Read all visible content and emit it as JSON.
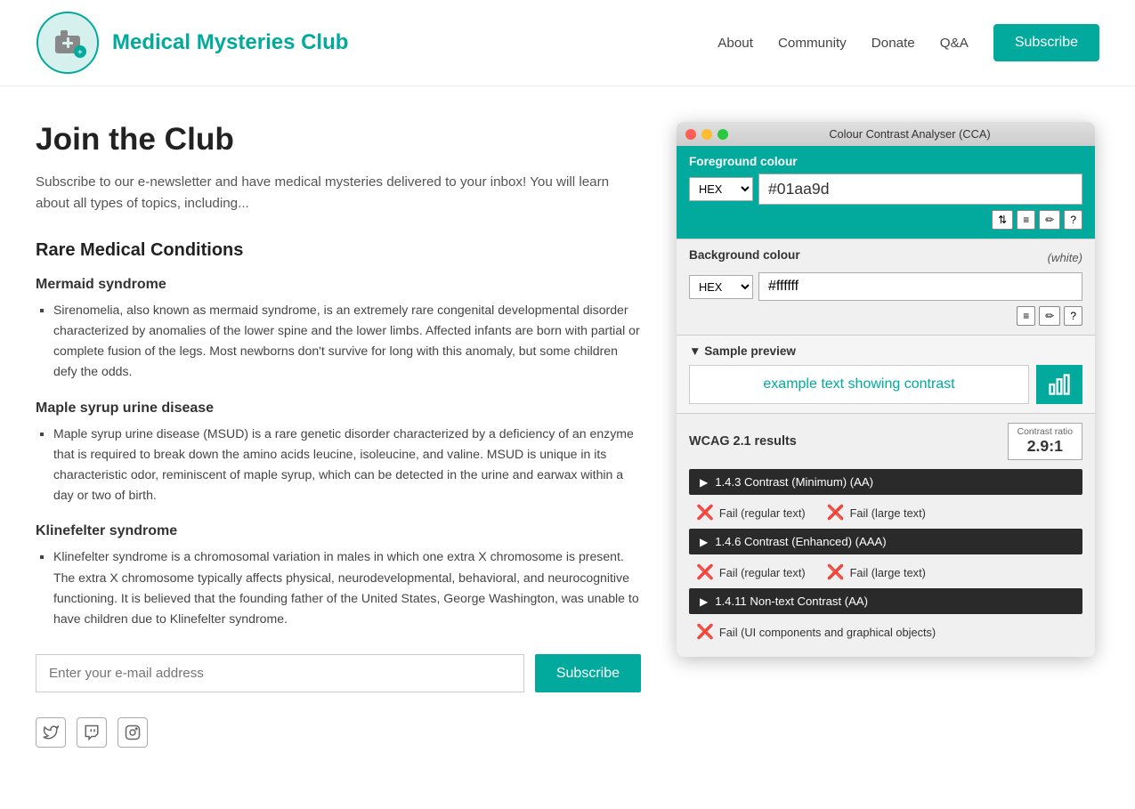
{
  "header": {
    "site_title": "Medical Mysteries Club",
    "logo_alt": "Medical Mysteries Club logo",
    "nav": {
      "about": "About",
      "community": "Community",
      "donate": "Donate",
      "qa": "Q&A",
      "subscribe": "Subscribe"
    }
  },
  "main": {
    "page_title": "Join the Club",
    "intro": "Subscribe to our e-newsletter and have medical mysteries delivered to your inbox! You will learn about all types of topics, including...",
    "section_title": "Rare Medical Conditions",
    "conditions": [
      {
        "title": "Mermaid syndrome",
        "text": "Sirenomelia, also known as mermaid syndrome, is an extremely rare congenital developmental disorder characterized by anomalies of the lower spine and the lower limbs. Affected infants are born with partial or complete fusion of the legs. Most newborns don't survive for long with this anomaly, but some children defy the odds."
      },
      {
        "title": "Maple syrup urine disease",
        "text": "Maple syrup urine disease (MSUD) is a rare genetic disorder characterized by a deficiency of an enzyme that is required to break down the amino acids leucine, isoleucine, and valine. MSUD is unique in its characteristic odor, reminiscent of maple syrup, which can be detected in the urine and earwax within a day or two of birth."
      },
      {
        "title": "Klinefelter syndrome",
        "text": "Klinefelter syndrome is a chromosomal variation in males in which one extra X chromosome is present. The extra X chromosome typically affects physical, neurodevelopmental, behavioral, and neurocognitive functioning. It is believed that the founding father of the United States, George Washington, was unable to have children due to Klinefelter syndrome."
      }
    ],
    "email_placeholder": "Enter your e-mail address",
    "subscribe_label": "Subscribe"
  },
  "social": {
    "icons": [
      "twitter-icon",
      "twitch-icon",
      "instagram-icon"
    ]
  },
  "cca": {
    "title": "Colour Contrast Analyser (CCA)",
    "fg_label": "Foreground colour",
    "fg_format": "HEX",
    "fg_value": "#01aa9d",
    "bg_label": "Background colour",
    "bg_note": "(white)",
    "bg_format": "HEX",
    "bg_value": "#ffffff",
    "sample_preview_header": "▼ Sample preview",
    "sample_text": "example text showing contrast",
    "wcag_header": "WCAG 2.1 results",
    "contrast_label": "Contrast ratio",
    "contrast_value": "2.9:1",
    "results": [
      {
        "id": "1.4.3",
        "label": "1.4.3 Contrast (Minimum) (AA)",
        "fail_regular": "Fail (regular text)",
        "fail_large": "Fail (large text)"
      },
      {
        "id": "1.4.6",
        "label": "1.4.6 Contrast (Enhanced) (AAA)",
        "fail_regular": "Fail (regular text)",
        "fail_large": "Fail (large text)"
      },
      {
        "id": "1.4.11",
        "label": "1.4.11 Non-text Contrast (AA)",
        "fail_ui": "Fail (UI components and graphical objects)"
      }
    ],
    "tool_buttons": {
      "swap": "⇅",
      "settings": "≡",
      "eyedropper": "✏",
      "help": "?"
    },
    "colors": {
      "teal": "#01aa9d",
      "dark": "#2a2a2a"
    }
  }
}
